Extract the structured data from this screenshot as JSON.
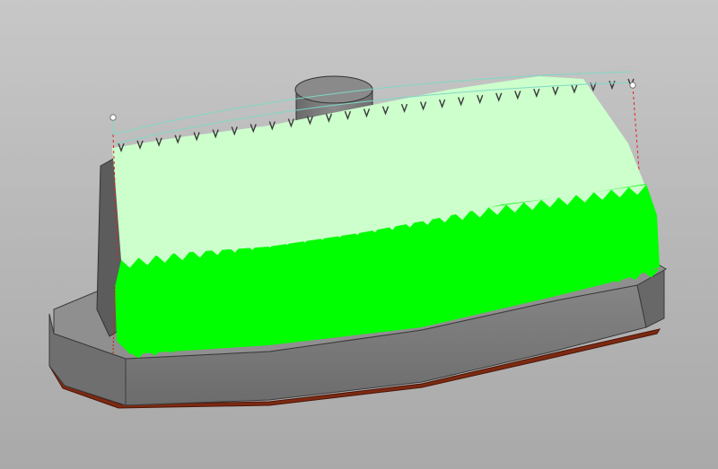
{
  "viewport": {
    "label": "",
    "background_top": "#c7c7c7",
    "background_bottom": "#a9a9a9"
  },
  "model": {
    "base_top_color": "#8e8e8e",
    "base_side_color": "#767676",
    "build_plate_color": "#7d2a12",
    "cylinder_color": "#7a7a7a",
    "support_upper_color": "#ccffcc",
    "support_lower_color": "#00ff00",
    "part_edge_color": "#555555"
  },
  "overlay": {
    "guide_line_color": "#7fd8c4",
    "marker_dash_color": "#e02020",
    "handle_color": "#ffffff",
    "handles": [
      "left-handle",
      "right-handle"
    ]
  }
}
